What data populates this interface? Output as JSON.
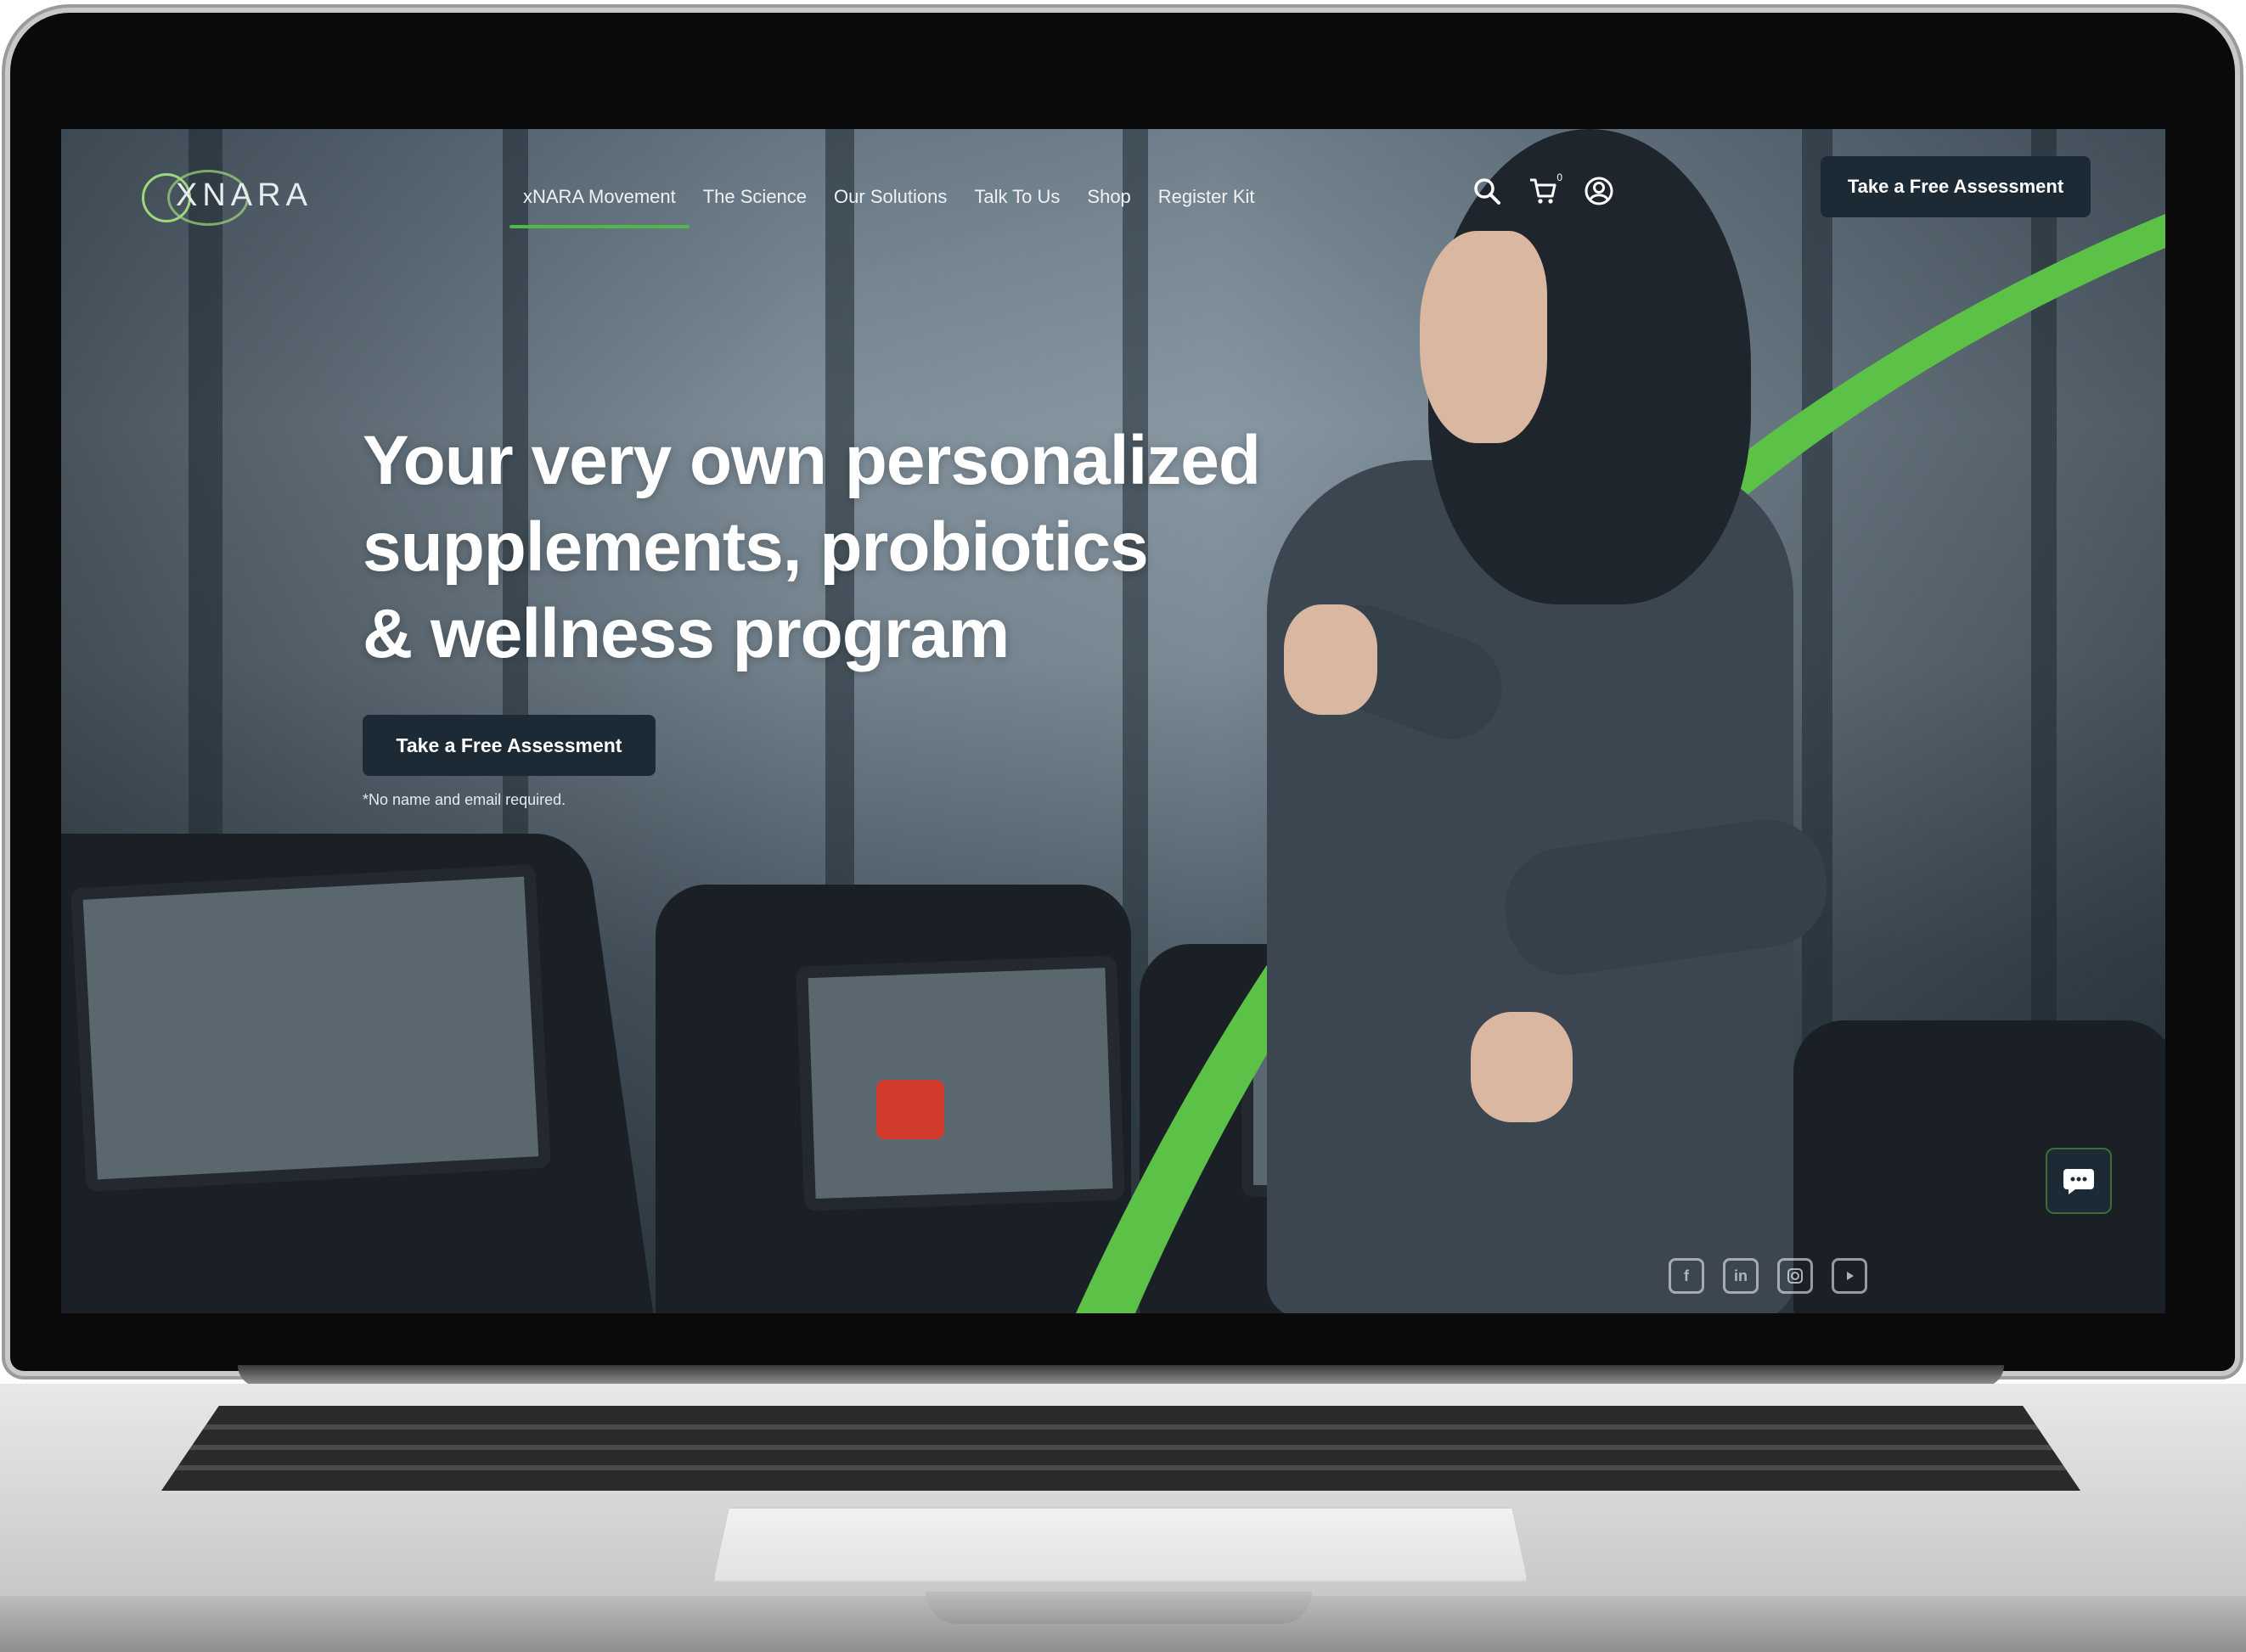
{
  "brand": {
    "logo_text": "XNARA",
    "accent_color": "#4fb84a",
    "dark_button_color": "#1c2a36"
  },
  "nav": {
    "items": [
      {
        "label": "xNARA Movement",
        "active": true
      },
      {
        "label": "The Science",
        "active": false
      },
      {
        "label": "Our Solutions",
        "active": false
      },
      {
        "label": "Talk To Us",
        "active": false
      },
      {
        "label": "Shop",
        "active": false
      },
      {
        "label": "Register Kit",
        "active": false
      }
    ],
    "icons": [
      "search-icon",
      "cart-icon",
      "account-icon"
    ],
    "cart_count": "0",
    "cta_label": "Take a Free Assessment"
  },
  "hero": {
    "title_lines": [
      "Your very own personalized",
      "supplements, probiotics",
      "& wellness program"
    ],
    "cta_label": "Take a Free Assessment",
    "note": "*No name and email required."
  },
  "chat": {
    "icon": "chat-icon"
  },
  "social": [
    "facebook-icon",
    "linkedin-icon",
    "instagram-icon",
    "youtube-icon"
  ]
}
